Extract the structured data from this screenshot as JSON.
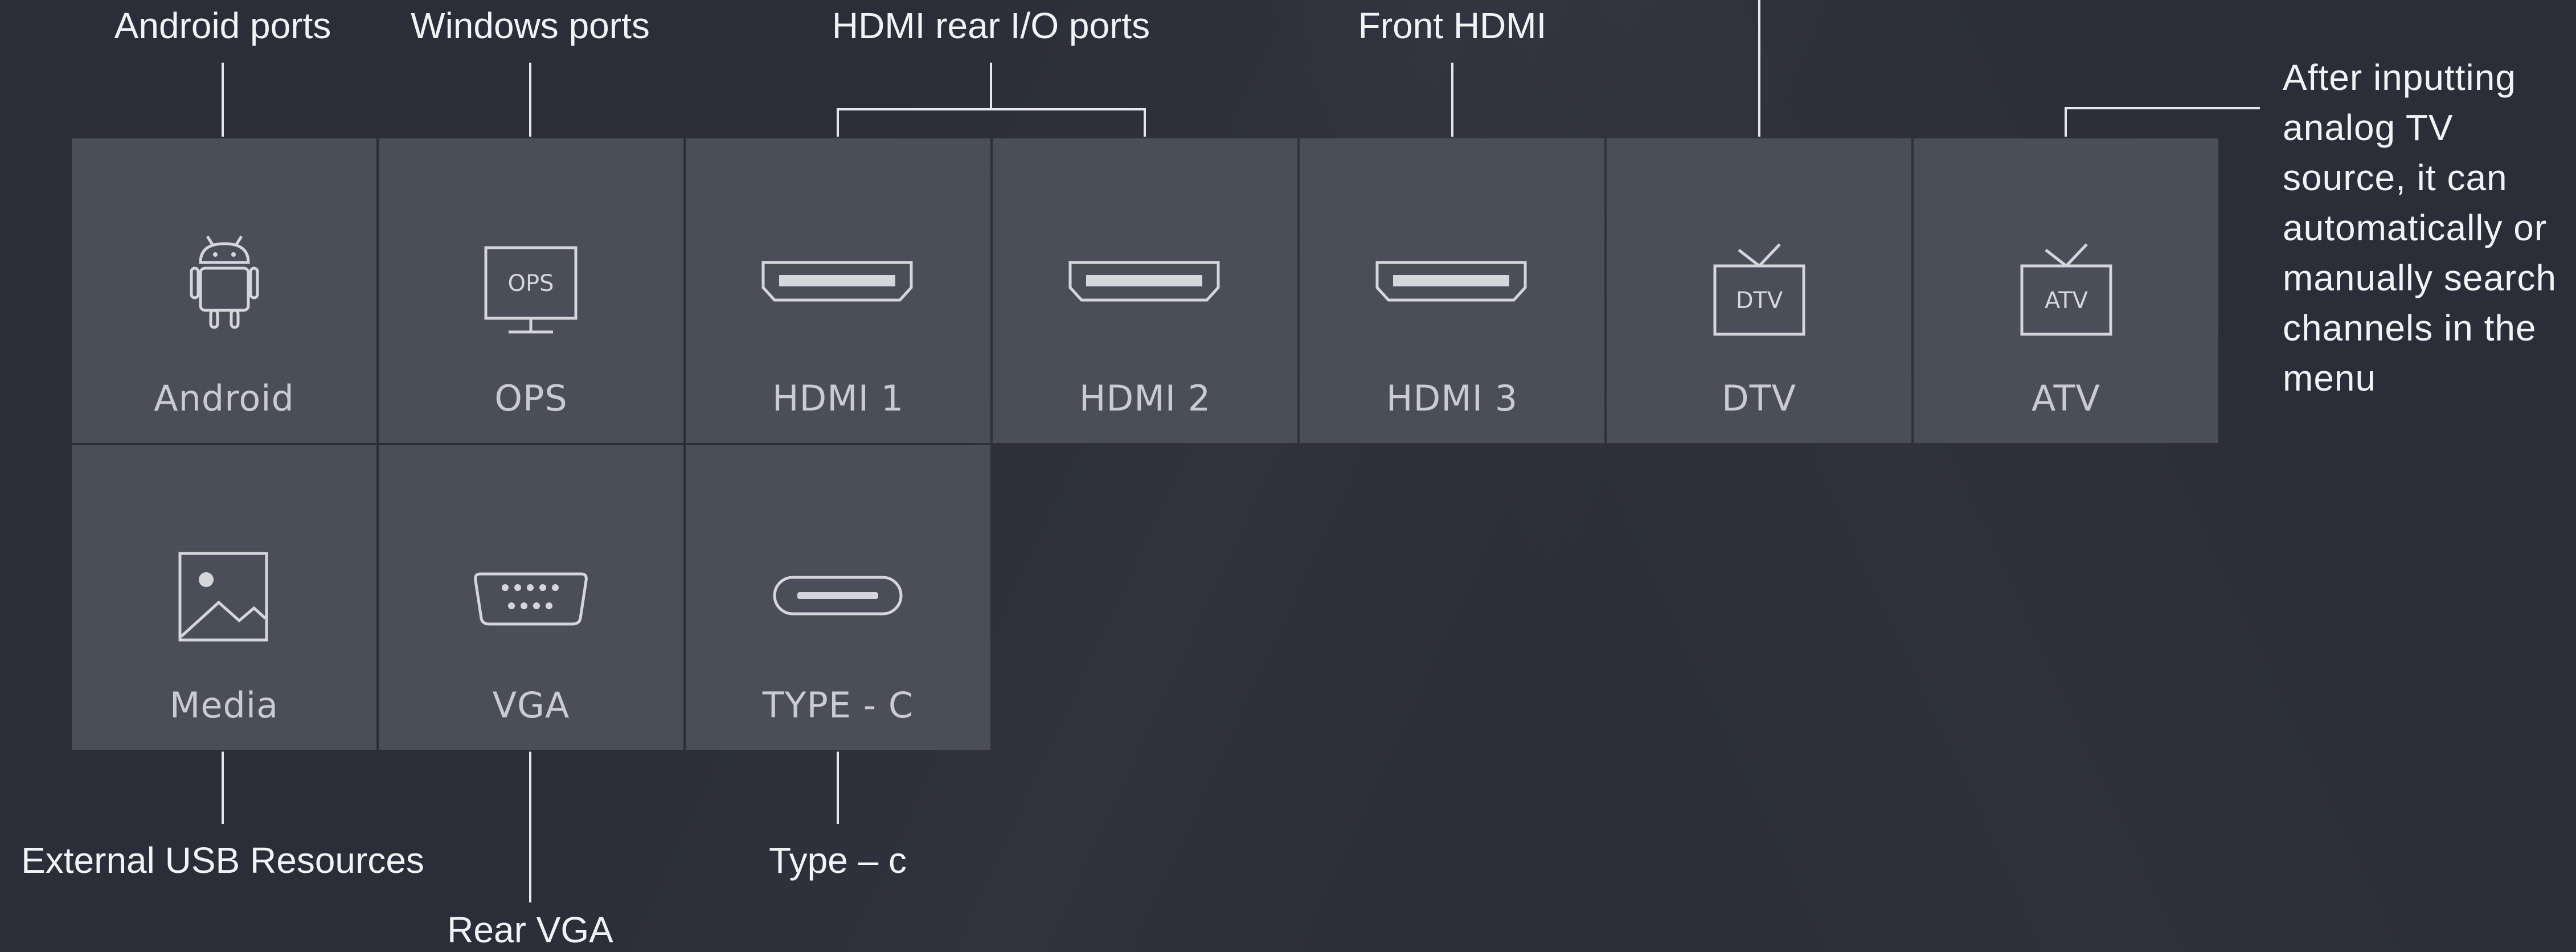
{
  "sources": [
    {
      "id": "android",
      "label": "Android",
      "icon": "android-icon"
    },
    {
      "id": "ops",
      "label": "OPS",
      "icon": "ops-monitor-icon",
      "icon_text": "OPS"
    },
    {
      "id": "hdmi1",
      "label": "HDMI 1",
      "icon": "hdmi-port-icon"
    },
    {
      "id": "hdmi2",
      "label": "HDMI 2",
      "icon": "hdmi-port-icon"
    },
    {
      "id": "hdmi3",
      "label": "HDMI 3",
      "icon": "hdmi-port-icon"
    },
    {
      "id": "dtv",
      "label": "DTV",
      "icon": "tv-icon",
      "icon_text": "DTV"
    },
    {
      "id": "atv",
      "label": "ATV",
      "icon": "tv-icon",
      "icon_text": "ATV"
    },
    {
      "id": "media",
      "label": "Media",
      "icon": "image-icon"
    },
    {
      "id": "vga",
      "label": "VGA",
      "icon": "vga-port-icon"
    },
    {
      "id": "typec",
      "label": "TYPE - C",
      "icon": "usb-c-port-icon"
    }
  ],
  "callouts": {
    "android_ports": "Android ports",
    "windows_ports": "Windows ports",
    "hdmi_rear": "HDMI rear I/O ports",
    "front_hdmi": "Front HDMI",
    "external_usb": "External USB Resources",
    "rear_vga": "Rear VGA",
    "type_c": "Type – c",
    "atv_note": "After inputting analog TV source, it can automatically or manually search channels in the menu"
  },
  "colors": {
    "background": "#2b2e39",
    "tile": "#4a4e59",
    "tile_label": "#c9cbd1",
    "callout_text": "#f2f3f5"
  }
}
